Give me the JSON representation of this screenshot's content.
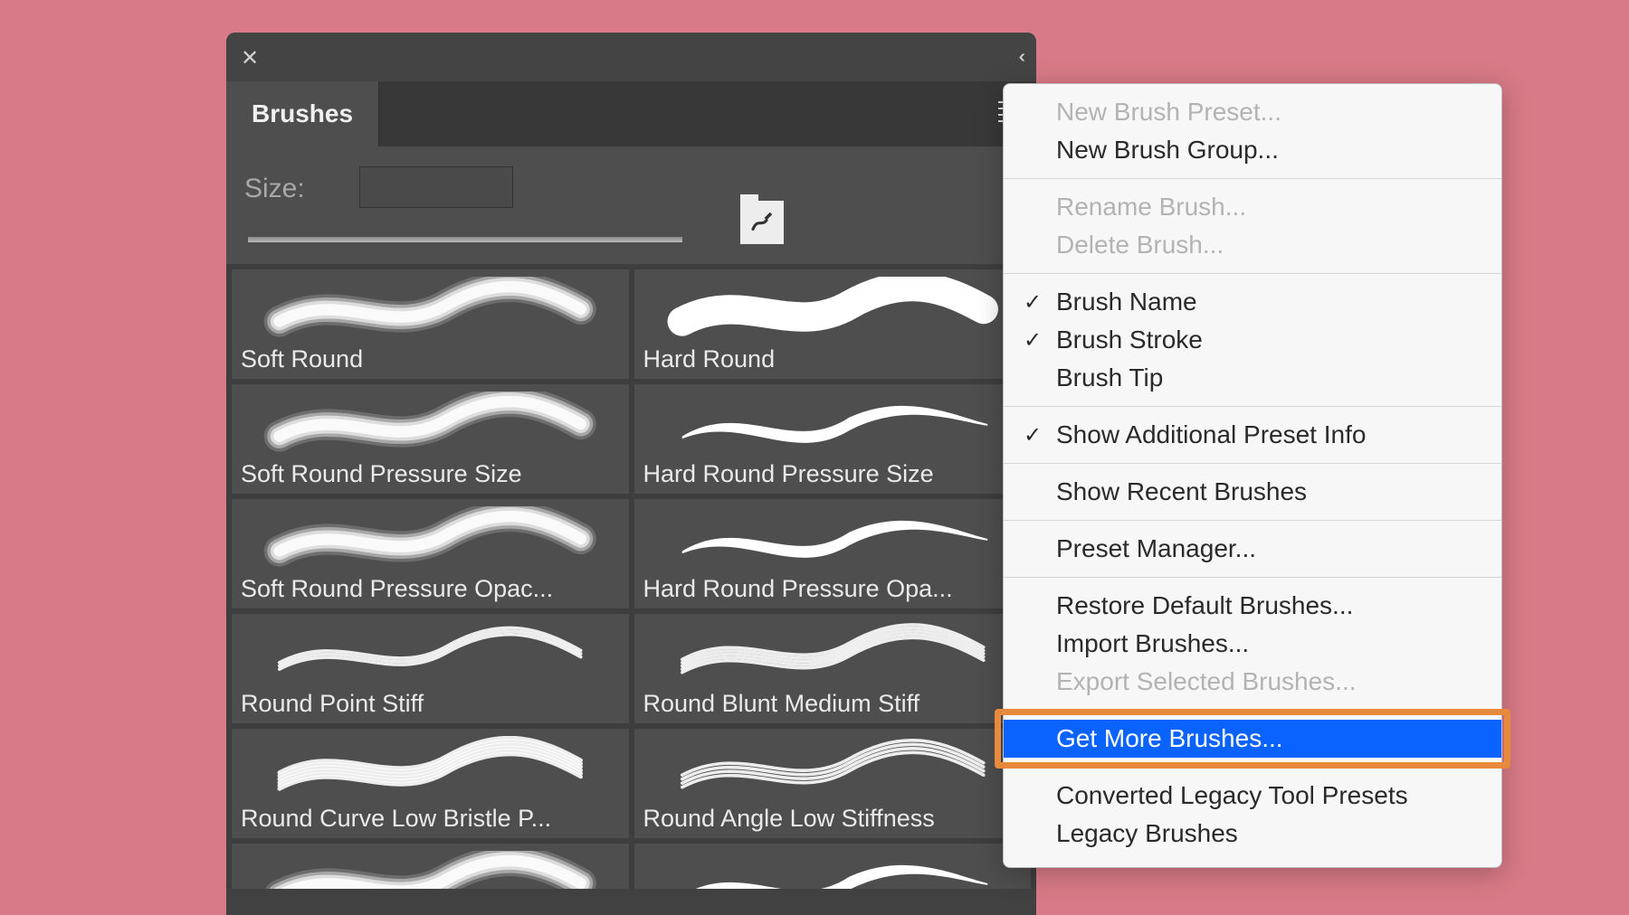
{
  "panel": {
    "tab_title": "Brushes",
    "size_label": "Size:"
  },
  "brushes": [
    {
      "name": "Soft Round",
      "kind": "soft"
    },
    {
      "name": "Hard Round",
      "kind": "hard"
    },
    {
      "name": "Soft Round Pressure Size",
      "kind": "soft"
    },
    {
      "name": "Hard Round Pressure Size",
      "kind": "hardtaper"
    },
    {
      "name": "Soft Round Pressure Opac...",
      "kind": "soft"
    },
    {
      "name": "Hard Round Pressure Opa...",
      "kind": "hardtaper"
    },
    {
      "name": "Round Point Stiff",
      "kind": "bristle1"
    },
    {
      "name": "Round Blunt Medium Stiff",
      "kind": "bristle2"
    },
    {
      "name": "Round Curve Low Bristle P...",
      "kind": "bristle3"
    },
    {
      "name": "Round Angle Low Stiffness",
      "kind": "bristle4"
    }
  ],
  "menu": {
    "groups": [
      [
        {
          "label": "New Brush Preset...",
          "disabled": true
        },
        {
          "label": "New Brush Group...",
          "disabled": false
        }
      ],
      [
        {
          "label": "Rename Brush...",
          "disabled": true
        },
        {
          "label": "Delete Brush...",
          "disabled": true
        }
      ],
      [
        {
          "label": "Brush Name",
          "checked": true
        },
        {
          "label": "Brush Stroke",
          "checked": true
        },
        {
          "label": "Brush Tip",
          "checked": false
        }
      ],
      [
        {
          "label": "Show Additional Preset Info",
          "checked": true
        }
      ],
      [
        {
          "label": "Show Recent Brushes"
        }
      ],
      [
        {
          "label": "Preset Manager..."
        }
      ],
      [
        {
          "label": "Restore Default Brushes..."
        },
        {
          "label": "Import Brushes..."
        },
        {
          "label": "Export Selected Brushes...",
          "disabled": true
        }
      ],
      [
        {
          "label": "Get More Brushes...",
          "highlighted": true
        }
      ],
      [
        {
          "label": "Converted Legacy Tool Presets"
        },
        {
          "label": "Legacy Brushes"
        }
      ]
    ]
  }
}
